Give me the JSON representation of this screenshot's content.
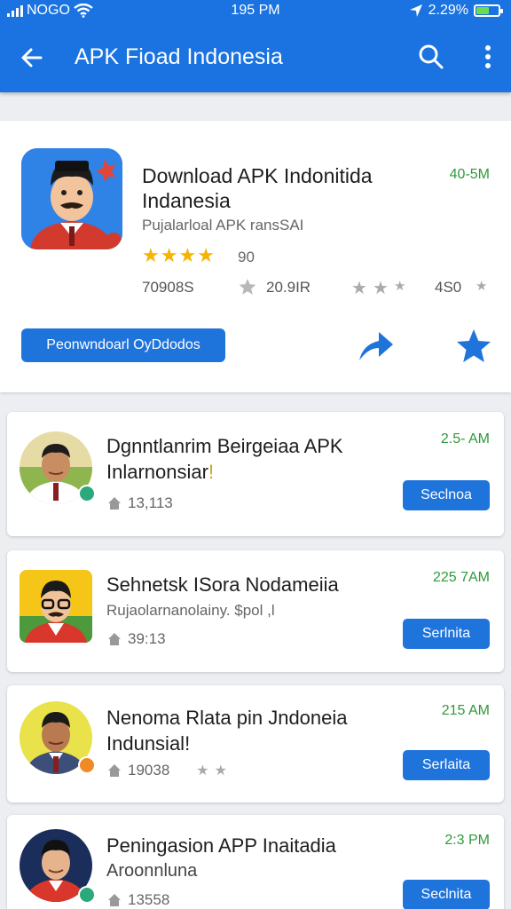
{
  "status_bar": {
    "carrier": "NOGO",
    "time": "195 PM",
    "battery": "2.29%"
  },
  "toolbar": {
    "title": "APK Fioad Indonesia",
    "icons": [
      "back-arrow-icon",
      "search-icon",
      "more-vert-icon"
    ]
  },
  "featured": {
    "name_line1": "Download APK Indonitida",
    "name_line2": "Indanesia",
    "developer": "Pujalarloal APK ransSAI",
    "size": "40-5M",
    "stars": [
      "★",
      "★",
      "★",
      "★"
    ],
    "rating_count": "90",
    "downloads": "70908S",
    "star_stat": "20.9IR",
    "small_stars": [
      "★",
      "★",
      "★"
    ],
    "small_stars_2": [
      "★"
    ],
    "rating_value": "4S0",
    "button_label": "Peonwndoarl OyDdodos",
    "colors": {
      "accent": "#1f74dc",
      "star": "#f4b400",
      "size": "#2f9a3a"
    }
  },
  "list": [
    {
      "title_line1": "Dgnntlanrim Beirgeiaa APK",
      "title_line2": "Inlarnonsiar",
      "title_mark": "!",
      "meta": "13,113",
      "time": "2.5- AM",
      "button": "Seclnoa"
    },
    {
      "title_line1": "Sehnetsk ISora Nodameiia",
      "subtitle": "Rujaolarnanolainy. $pol ,l",
      "meta": "39:13",
      "time": "225 7AM",
      "button": "Serlnita"
    },
    {
      "title_line1": "Nenoma Rlata pin Jndoneia",
      "title_line2": "Indunsial!",
      "meta": "19038",
      "meta_stars": [
        "★",
        "★"
      ],
      "time": "215 AM",
      "button": "Serlaita"
    },
    {
      "title_line1": "Peningasion APP Inaitadia",
      "subtitle": "Aroonnluna",
      "meta": "13558",
      "time": "2:3 PM",
      "button": "Seclnita"
    }
  ]
}
